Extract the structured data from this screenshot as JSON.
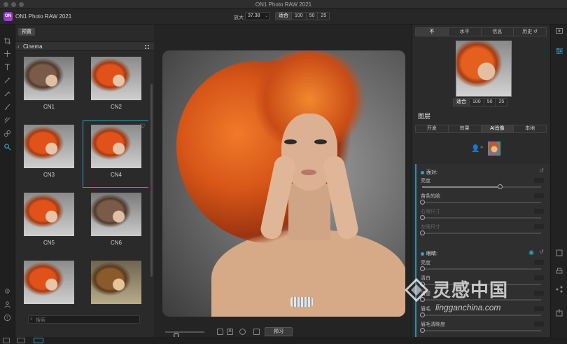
{
  "window": {
    "title": "ON1 Photo RAW 2021"
  },
  "app": {
    "logo": "ON",
    "name": "ON1 Photo RAW 2021"
  },
  "zoom": {
    "label": "放大",
    "value": "37.38",
    "fit_options": [
      "适合",
      "100",
      "50",
      "25"
    ]
  },
  "browser": {
    "tab_label": "预置",
    "category": "Cinema",
    "presets": [
      {
        "label": "CN1",
        "tone": "brown"
      },
      {
        "label": "CN2",
        "tone": "orange"
      },
      {
        "label": "CN3",
        "tone": "orange"
      },
      {
        "label": "CN4",
        "tone": "orange",
        "selected": true
      },
      {
        "label": "CN5",
        "tone": "orange"
      },
      {
        "label": "CN6",
        "tone": "brown"
      },
      {
        "label": "",
        "tone": "orange"
      },
      {
        "label": "",
        "tone": "warm"
      }
    ],
    "search_placeholder": "搜索"
  },
  "canvas": {
    "preview_label": "预习"
  },
  "navigator": {
    "tabs": [
      "不",
      "水平",
      "信息",
      "历史"
    ],
    "zoom_options": [
      "适合",
      "100",
      "50",
      "25"
    ]
  },
  "layers": {
    "title": "图层",
    "filter_tabs": [
      "开发",
      "效果",
      "AI肖像",
      "本地"
    ],
    "active_tab": "AI肖像"
  },
  "adjustments": {
    "face_section": {
      "title": "面对:",
      "sliders": [
        {
          "label": "亮度",
          "value": 0.65,
          "dim": false
        },
        {
          "label": "苗条的脸",
          "value": 0.0,
          "dim": false
        },
        {
          "label": "右眼尺寸",
          "value": 0.0,
          "dim": true
        },
        {
          "label": "左眼尺寸",
          "value": 0.0,
          "dim": true
        }
      ]
    },
    "eyes_section": {
      "title": "眼睛:",
      "sliders": [
        {
          "label": "亮度",
          "value": 0.0,
          "dim": false
        },
        {
          "label": "清白",
          "value": 0.0,
          "dim": false
        },
        {
          "label": "清楚",
          "value": 0.0,
          "dim": false
        },
        {
          "label": "眉毛",
          "value": 0.0,
          "dim": false
        },
        {
          "label": "眉毛清晰度",
          "value": 0.0,
          "dim": false
        }
      ]
    }
  },
  "watermark": {
    "zh": "灵感中国",
    "en": "lingganchina.com"
  },
  "colors": {
    "accent": "#2aa3c7",
    "panel": "#2b2b2b",
    "background": "#242424"
  }
}
